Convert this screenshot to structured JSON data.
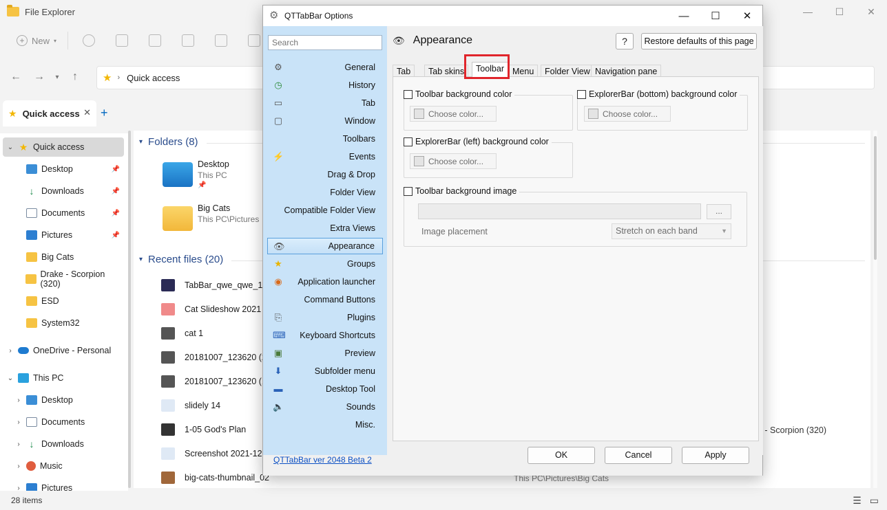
{
  "explorer": {
    "title": "File Explorer",
    "ribbon": {
      "new_label": "New"
    },
    "address": {
      "path": "Quick access"
    },
    "tab": {
      "label": "Quick access"
    },
    "nav": [
      {
        "label": "Quick access",
        "icon": "star-icon",
        "pinned": false
      },
      {
        "label": "Desktop",
        "icon": "desktop-icon",
        "pinned": true
      },
      {
        "label": "Downloads",
        "icon": "download-icon",
        "pinned": true
      },
      {
        "label": "Documents",
        "icon": "documents-icon",
        "pinned": true
      },
      {
        "label": "Pictures",
        "icon": "pictures-icon",
        "pinned": true
      },
      {
        "label": "Big Cats",
        "icon": "folder-icon",
        "pinned": false
      },
      {
        "label": "Drake - Scorpion (320)",
        "icon": "folder-icon",
        "pinned": false
      },
      {
        "label": "ESD",
        "icon": "folder-icon",
        "pinned": false
      },
      {
        "label": "System32",
        "icon": "folder-icon",
        "pinned": false
      },
      {
        "label": "OneDrive - Personal",
        "icon": "cloud-icon",
        "pinned": false
      },
      {
        "label": "This PC",
        "icon": "pc-icon",
        "pinned": false
      },
      {
        "label": "Desktop",
        "icon": "desktop-icon",
        "pinned": false
      },
      {
        "label": "Documents",
        "icon": "documents-icon",
        "pinned": false
      },
      {
        "label": "Downloads",
        "icon": "download-icon",
        "pinned": false
      },
      {
        "label": "Music",
        "icon": "music-icon",
        "pinned": false
      },
      {
        "label": "Pictures",
        "icon": "pictures-icon",
        "pinned": false
      }
    ],
    "folders_header": "Folders (8)",
    "folders": [
      {
        "name": "Desktop",
        "sub": "This PC"
      },
      {
        "name": "Big Cats",
        "sub": "This PC\\Pictures"
      }
    ],
    "recent_header": "Recent files (20)",
    "recent": [
      "TabBar_qwe_qwe_1_Ta",
      "Cat Slideshow 2021",
      "cat 1",
      "20181007_123620 (2)",
      "20181007_123620 (1)",
      "slidely 14",
      "1-05 God's Plan",
      "Screenshot 2021-12-28",
      "big-cats-thumbnail_02"
    ],
    "right_text_1": "e - Scorpion (320)",
    "right_text_2": "This PC\\Pictures\\Big Cats",
    "status": "28 items"
  },
  "dialog": {
    "title": "QTTabBar Options",
    "search_placeholder": "Search",
    "categories": [
      {
        "label": "General",
        "icon": "gear-icon"
      },
      {
        "label": "History",
        "icon": "history-icon"
      },
      {
        "label": "Tab",
        "icon": "tab-icon"
      },
      {
        "label": "Window",
        "icon": "window-icon"
      },
      {
        "label": "Toolbars",
        "icon": "toolbars-icon"
      },
      {
        "label": "Events",
        "icon": "lightning-icon"
      },
      {
        "label": "Drag & Drop",
        "icon": "drag-drop-icon"
      },
      {
        "label": "Folder View",
        "icon": "folder-view-icon"
      },
      {
        "label": "Compatible Folder View",
        "icon": "compatible-folder-view-icon"
      },
      {
        "label": "Extra Views",
        "icon": "extra-views-icon"
      },
      {
        "label": "Appearance",
        "icon": "eye-icon"
      },
      {
        "label": "Groups",
        "icon": "star-icon"
      },
      {
        "label": "Application launcher",
        "icon": "app-launcher-icon"
      },
      {
        "label": "Command Buttons",
        "icon": "command-buttons-icon"
      },
      {
        "label": "Plugins",
        "icon": "plugins-icon"
      },
      {
        "label": "Keyboard Shortcuts",
        "icon": "keyboard-icon"
      },
      {
        "label": "Preview",
        "icon": "preview-icon"
      },
      {
        "label": "Subfolder menu",
        "icon": "subfolder-menu-icon"
      },
      {
        "label": "Desktop Tool",
        "icon": "desktop-tool-icon"
      },
      {
        "label": "Sounds",
        "icon": "speaker-icon"
      },
      {
        "label": "Misc.",
        "icon": "misc-icon"
      }
    ],
    "active_category": "Appearance",
    "page_title": "Appearance",
    "help_label": "?",
    "restore_label": "Restore defaults of this page",
    "tabs": [
      "Tab",
      "Tab skins",
      "Toolbar",
      "Menu",
      "Folder View",
      "Navigation pane"
    ],
    "active_tab": "Toolbar",
    "toolbar_page": {
      "toolbar_bg_color": "Toolbar background color",
      "explorerbar_bottom_bg_color": "ExplorerBar (bottom) background color",
      "explorerbar_left_bg_color": "ExplorerBar (left) background color",
      "choose_color": "Choose color...",
      "toolbar_bg_image": "Toolbar background image",
      "browse_label": "...",
      "image_placement_label": "Image placement",
      "image_placement_value": "Stretch on each band"
    },
    "version_link": "QTTabBar ver 2048 Beta 2",
    "ok_label": "OK",
    "cancel_label": "Cancel",
    "apply_label": "Apply"
  },
  "colors": {
    "highlight": "#e0252b",
    "left_panel": "#c9e3f8",
    "link": "#0b50c4"
  }
}
